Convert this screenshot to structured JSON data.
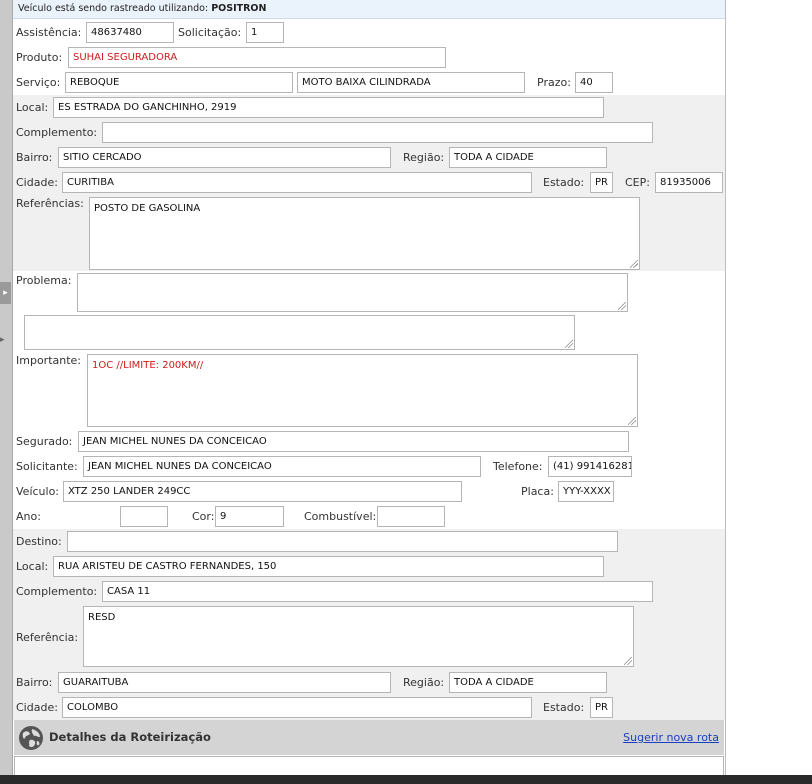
{
  "banner": {
    "prefix": "Veículo está sendo rastreado utilizando:",
    "system": "POSITRON"
  },
  "assistencia": {
    "label": "Assistência:",
    "value": "48637480"
  },
  "solicitacao": {
    "label": "Solicitação:",
    "value": "1"
  },
  "produto": {
    "label": "Produto:",
    "value": "SUHAI SEGURADORA"
  },
  "servico": {
    "label": "Serviço:",
    "value": "REBOQUE",
    "subtype": "MOTO BAIXA CILINDRADA"
  },
  "prazo": {
    "label": "Prazo:",
    "value": "40"
  },
  "origem": {
    "local_label": "Local:",
    "local": "ES ESTRADA DO GANCHINHO, 2919",
    "complemento_label": "Complemento:",
    "complemento": "",
    "bairro_label": "Bairro:",
    "bairro": "SITIO CERCADO",
    "regiao_label": "Região:",
    "regiao": "TODA A CIDADE",
    "cidade_label": "Cidade:",
    "cidade": "CURITIBA",
    "estado_label": "Estado:",
    "estado": "PR",
    "cep_label": "CEP:",
    "cep": "81935006",
    "referencias_label": "Referências:",
    "referencias": "POSTO DE GASOLINA"
  },
  "problema": {
    "label": "Problema:",
    "value": "",
    "extra": ""
  },
  "importante": {
    "label": "Importante:",
    "value": "1OC //LIMITE: 200KM//"
  },
  "segurado": {
    "label": "Segurado:",
    "value": "JEAN MICHEL NUNES DA CONCEICAO"
  },
  "solicitante": {
    "label": "Solicitante:",
    "value": "JEAN MICHEL NUNES DA CONCEICAO"
  },
  "telefone": {
    "label": "Telefone:",
    "value": "(41) 991416281"
  },
  "veiculo": {
    "label": "Veículo:",
    "value": "XTZ 250 LANDER 249CC"
  },
  "placa": {
    "label": "Placa:",
    "value": "YYY-XXXX"
  },
  "ano": {
    "label": "Ano:",
    "value": ""
  },
  "cor": {
    "label": "Cor:",
    "value": "9"
  },
  "combustivel": {
    "label": "Combustível:",
    "value": ""
  },
  "destino": {
    "destino_label": "Destino:",
    "destino": "",
    "local_label": "Local:",
    "local": "RUA ARISTEU DE CASTRO FERNANDES, 150",
    "complemento_label": "Complemento:",
    "complemento": "CASA 11",
    "referencia_label": "Referência:",
    "referencia": "RESD",
    "bairro_label": "Bairro:",
    "bairro": "GUARAITUBA",
    "regiao_label": "Região:",
    "regiao": "TODA A CIDADE",
    "cidade_label": "Cidade:",
    "cidade": "COLOMBO",
    "estado_label": "Estado:",
    "estado": "PR"
  },
  "footer": {
    "title": "Detalhes da Roteirização",
    "link": "Sugerir nova rota",
    "icon": "globe-icon"
  },
  "colors": {
    "red_text": "#cc1b1b",
    "band": "#f0f0f0",
    "link": "#1a3fbf"
  }
}
